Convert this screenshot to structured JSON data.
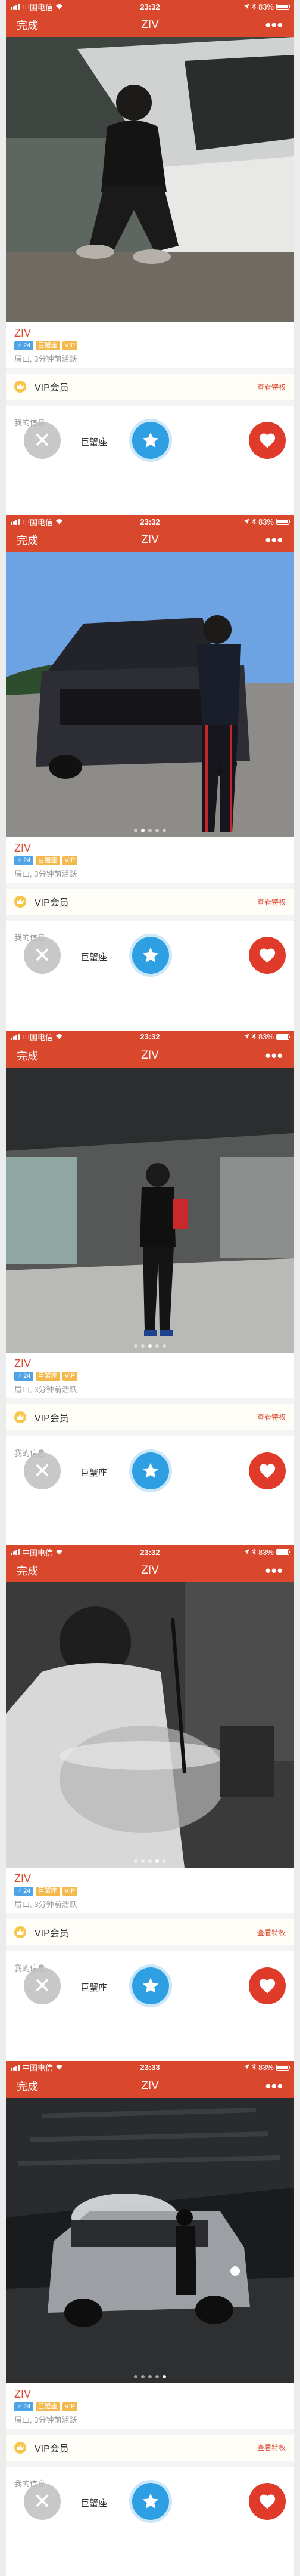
{
  "status_bar": {
    "carrier": "中国电信",
    "battery": "83%"
  },
  "nav": {
    "done_label": "完成",
    "title": "ZIV",
    "more_label": "•••"
  },
  "profile": {
    "name": "ZIV",
    "age_badge": "♂ 24",
    "zodiac_badge": "巨蟹座",
    "vip_badge": "VIP",
    "meta": "眉山, 3分钟前活跃"
  },
  "vip_row": {
    "label": "VIP会员",
    "link": "查看特权"
  },
  "info": {
    "title": "我的信息",
    "zodiac": "巨蟹座"
  },
  "colors": {
    "brand": "#d9472d",
    "like": "#e03b2a",
    "superlike": "#2f9fe3",
    "gold": "#f4b94c"
  },
  "screens": [
    {
      "time": "23:32",
      "photo": "man-sitting-on-car-door",
      "dots_total": 0,
      "dot_active": -1
    },
    {
      "time": "23:32",
      "photo": "man-by-open-car-trunk",
      "dots_total": 5,
      "dot_active": 1
    },
    {
      "time": "23:32",
      "photo": "man-in-shopping-mall",
      "dots_total": 5,
      "dot_active": 2
    },
    {
      "time": "23:32",
      "photo": "bw-man-with-glass-bowl",
      "dots_total": 5,
      "dot_active": 3
    },
    {
      "time": "23:33",
      "photo": "suv-in-underground-garage",
      "dots_total": 5,
      "dot_active": 4
    }
  ]
}
